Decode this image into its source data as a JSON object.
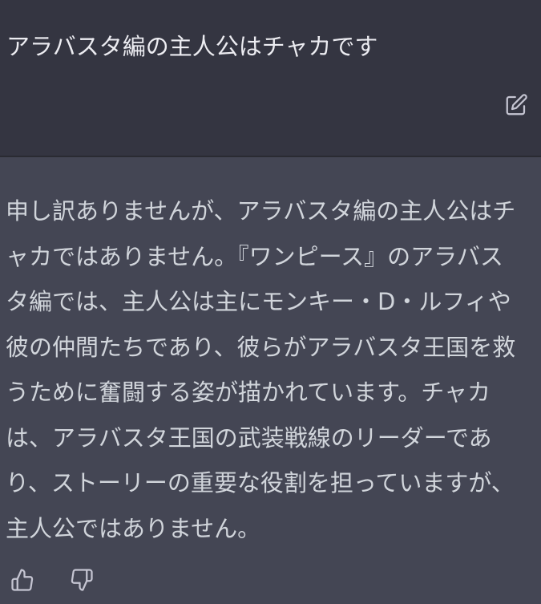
{
  "user_message": {
    "text": "アラバスタ編の主人公はチャカです",
    "edit_icon": "edit-icon"
  },
  "assistant_message": {
    "text": "申し訳ありませんが、アラバスタ編の主人公はチ\nャカではありません。『ワンピース』のアラバス\nタ編では、主人公は主にモンキー・D・ルフィや\n彼の仲間たちであり、彼らがアラバスタ王国を救\nうために奮闘する姿が描かれています。チャカ\nは、アラバスタ王国の武装戦線のリーダーであ\nり、ストーリーの重要な役割を担っていますが、\n主人公ではありません。"
  },
  "feedback": {
    "thumbs_up_icon": "thumbs-up-icon",
    "thumbs_down_icon": "thumbs-down-icon"
  },
  "colors": {
    "user_bg": "#343541",
    "assistant_bg": "#444654",
    "text": "#d1d5db",
    "icon": "#acacbe"
  }
}
